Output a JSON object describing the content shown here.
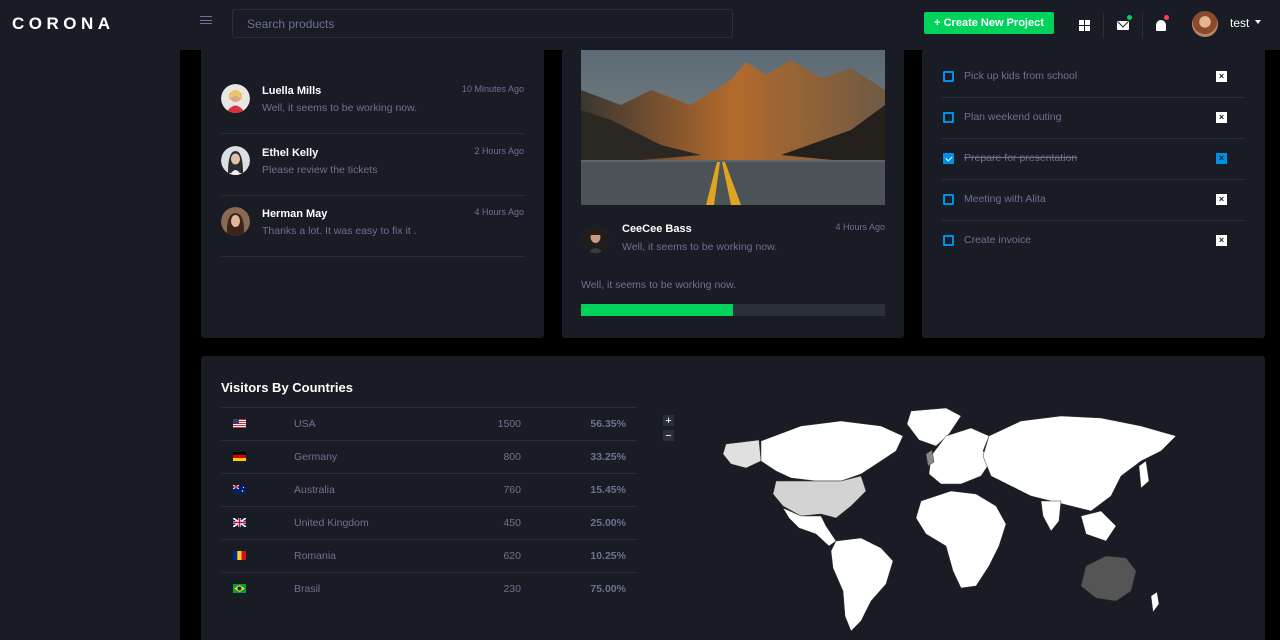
{
  "brand": "CORONA",
  "navbar": {
    "search_placeholder": "Search products",
    "create_button": "+ Create New Project",
    "user_name": "test"
  },
  "messages": {
    "items": [
      {
        "name": "Luella Mills",
        "text": "Well, it seems to be working now.",
        "time": "10 Minutes Ago"
      },
      {
        "name": "Ethel Kelly",
        "text": "Please review the tickets",
        "time": "2 Hours Ago"
      },
      {
        "name": "Herman May",
        "text": "Thanks a lot. It was easy to fix it .",
        "time": "4 Hours Ago"
      }
    ]
  },
  "post": {
    "author": "CeeCee Bass",
    "text": "Well, it seems to be working now.",
    "time": "4 Hours Ago",
    "quote": "Well, it seems to be working now.",
    "progress_fraction": 0.5
  },
  "todo": {
    "items": [
      {
        "label": "Pick up kids from school",
        "done": false
      },
      {
        "label": "Plan weekend outing",
        "done": false
      },
      {
        "label": "Prepare for presentation",
        "done": true
      },
      {
        "label": "Meeting with Alita",
        "done": false
      },
      {
        "label": "Create invoice",
        "done": false
      }
    ]
  },
  "visitors": {
    "title": "Visitors By Countries",
    "rows": [
      {
        "flag": "us-flag",
        "country": "USA",
        "visits": "1500",
        "percent": "56.35%"
      },
      {
        "flag": "de-flag",
        "country": "Germany",
        "visits": "800",
        "percent": "33.25%"
      },
      {
        "flag": "au-flag",
        "country": "Australia",
        "visits": "760",
        "percent": "15.45%"
      },
      {
        "flag": "gb-flag",
        "country": "United Kingdom",
        "visits": "450",
        "percent": "25.00%"
      },
      {
        "flag": "ro-flag",
        "country": "Romania",
        "visits": "620",
        "percent": "10.25%"
      },
      {
        "flag": "br-flag",
        "country": "Brasil",
        "visits": "230",
        "percent": "75.00%"
      }
    ],
    "zoom_in": "+",
    "zoom_out": "−"
  },
  "colors": {
    "accent_green": "#00d25b",
    "accent_blue": "#0090e7",
    "card_bg": "#191c24",
    "muted_text": "#6c7293"
  }
}
